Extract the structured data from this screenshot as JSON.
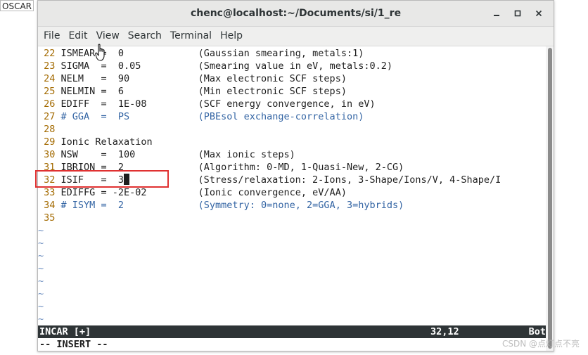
{
  "desktop": {
    "file_label": "OSCAR"
  },
  "window": {
    "title": "chenc@localhost:~/Documents/si/1_re",
    "controls": {
      "minimize": "—",
      "maximize": "□",
      "close": "✕"
    }
  },
  "menu": [
    "File",
    "Edit",
    "View",
    "Search",
    "Terminal",
    "Help"
  ],
  "editor": {
    "lines": [
      {
        "num": "22",
        "text": "ISMEAR =  0             ",
        "comment": "(Gaussian smearing, metals:1)",
        "is_comment": false
      },
      {
        "num": "23",
        "text": "SIGMA  =  0.05          ",
        "comment": "(Smearing value in eV, metals:0.2)",
        "is_comment": false
      },
      {
        "num": "24",
        "text": "NELM   =  90            ",
        "comment": "(Max electronic SCF steps)",
        "is_comment": false
      },
      {
        "num": "25",
        "text": "NELMIN =  6             ",
        "comment": "(Min electronic SCF steps)",
        "is_comment": false
      },
      {
        "num": "26",
        "text": "EDIFF  =  1E-08         ",
        "comment": "(SCF energy convergence, in eV)",
        "is_comment": false
      },
      {
        "num": "27",
        "text": "# GGA  =  PS            ",
        "comment": "(PBEsol exchange-correlation)",
        "is_comment": true
      },
      {
        "num": "28",
        "text": "",
        "comment": "",
        "is_comment": false
      },
      {
        "num": "29",
        "text": "Ionic Relaxation",
        "comment": "",
        "is_comment": false
      },
      {
        "num": "30",
        "text": "NSW    =  100           ",
        "comment": "(Max ionic steps)",
        "is_comment": false
      },
      {
        "num": "31",
        "text": "IBRION =  2             ",
        "comment": "(Algorithm: 0-MD, 1-Quasi-New, 2-CG)",
        "is_comment": false
      },
      {
        "num": "32",
        "text": "ISIF   =  3",
        "comment": "(Stress/relaxation: 2-Ions, 3-Shape/Ions/V, 4-Shape/I",
        "is_comment": false,
        "cursor": true
      },
      {
        "num": "33",
        "text": "EDIFFG = -2E-02         ",
        "comment": "(Ionic convergence, eV/AA)",
        "is_comment": false
      },
      {
        "num": "34",
        "text": "# ISYM =  2             ",
        "comment": "(Symmetry: 0=none, 2=GGA, 3=hybrids)",
        "is_comment": true
      },
      {
        "num": "35",
        "text": "",
        "comment": "",
        "is_comment": false
      }
    ],
    "tilde_rows": 8,
    "tilde_char": "~"
  },
  "status": {
    "filename": "INCAR [+]",
    "position": "32,12",
    "scroll": "Bot"
  },
  "mode": "-- INSERT --",
  "watermark": "CSDN @点灯点不亮",
  "colors": {
    "line_number": "#a36a00",
    "comment": "#3465a4",
    "highlight": "#e03131",
    "status_bg": "#2e3436"
  }
}
